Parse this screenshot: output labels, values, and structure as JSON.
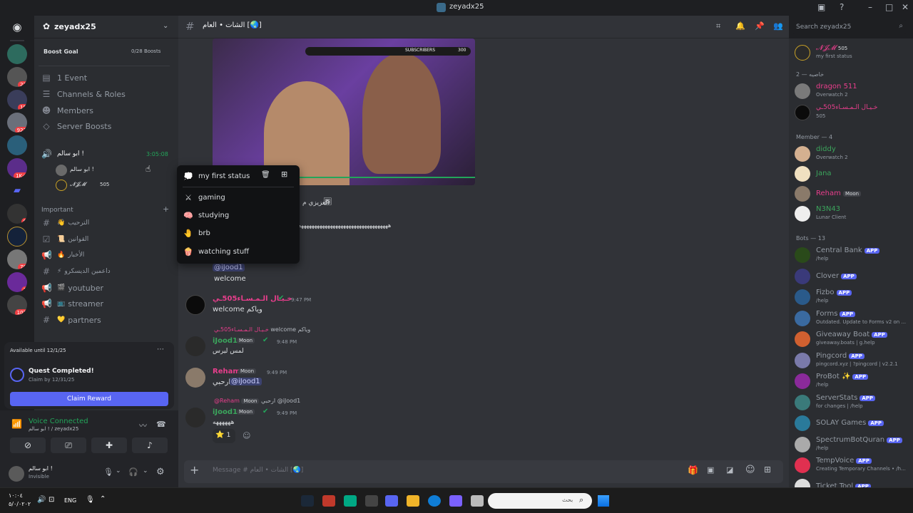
{
  "window": {
    "title": "zeyadx25"
  },
  "colors": {
    "accent": "#5865f2",
    "online": "#23a55a",
    "danger": "#f23f43",
    "pink": "#e83e8c",
    "green_name": "#3ba55c"
  },
  "server": {
    "name": "zeyadx25",
    "boost_goal_label": "Boost Goal",
    "boost_goal_value": "0/28 Boosts",
    "menu": [
      "1 Event",
      "Channels & Roles",
      "Members",
      "Server Boosts"
    ],
    "voice_channel": {
      "name": "ابو سالم !",
      "timer": "3:05:08",
      "users": [
        "ابو سالم !",
        "𝓝𝓙𝓜"
      ],
      "user_tag": "505"
    },
    "category_important": "Important",
    "channels": [
      {
        "icon": "#",
        "emoji": "👋",
        "name": "الترحيب"
      },
      {
        "icon": "☑",
        "emoji": "📜",
        "name": "القوانين"
      },
      {
        "icon": "📢",
        "emoji": "🔥",
        "name": "الأخبار"
      },
      {
        "icon": "#",
        "emoji": "⚡",
        "name": "داعمين الديسكرو"
      },
      {
        "icon": "📢",
        "emoji": "🎬",
        "name": "youtuber"
      },
      {
        "icon": "📢",
        "emoji": "📺",
        "name": "streamer"
      },
      {
        "icon": "#",
        "emoji": "💛",
        "name": "partners"
      }
    ],
    "server_badges": [
      "22",
      "15",
      "923",
      "1K+",
      "6",
      "70",
      "1",
      "102"
    ]
  },
  "quest": {
    "availability": "Available until 12/1/25",
    "title": "Quest Completed!",
    "claim_by": "Claim by 12/31/25",
    "button": "Claim Reward"
  },
  "voice": {
    "status": "Voice Connected",
    "location": "ابو سالم ! / zeyadx25"
  },
  "user": {
    "name": "ابو سالم !",
    "status": "Invisible"
  },
  "chat": {
    "channel_name": "الشات • العام [🌏]",
    "search_placeholder": "Search zeyadx25",
    "video": {
      "overlay_label": "SUBSCRIBERS",
      "overlay_value": "300"
    },
    "after_video_text": "العزيزي م",
    "long_text": "ههههههههههههههههههههههههههههههههههه",
    "messages": [
      {
        "mention": "@iJood1",
        "body": "welcome"
      },
      {
        "author": "خـيـال الـمـسـاء505ـي",
        "time": "9:47 PM",
        "body": "welcome وياكم"
      },
      {
        "reply_to": "خـيـال الـمـسـاء505ـي",
        "reply_text": "welcome وياكم",
        "author": "iJood1",
        "tag": "Moon",
        "time": "9:48 PM",
        "body": "لمس ليرس"
      },
      {
        "author": "Reham",
        "tag": "Moon",
        "time": "9:49 PM",
        "body": "ارحبي",
        "mention": "@iJood1"
      },
      {
        "reply_to": "@Reham",
        "reply_tag": "Moon",
        "reply_text": "ارحبي @iJood1",
        "author": "iJood1",
        "tag": "Moon",
        "time": "9:49 PM",
        "body": "ههههههه",
        "reaction_count": "1"
      }
    ],
    "composer_placeholder": "Message # الشات • العام [🌏]"
  },
  "status_popup": {
    "current": "my first status",
    "options": [
      {
        "emoji": "⚔",
        "label": "gaming"
      },
      {
        "emoji": "🧠",
        "label": "studying"
      },
      {
        "emoji": "🤚",
        "label": "brb"
      },
      {
        "emoji": "🍿",
        "label": "watching stuff"
      }
    ]
  },
  "members": {
    "top_user": {
      "name": "𝓝𝓙𝓜",
      "tag": "505",
      "status": "my first status"
    },
    "category_1": "خاصيه — 2",
    "group_1": [
      {
        "name": "dragon 511",
        "sub": "Overwatch 2",
        "color": "#e83e8c"
      },
      {
        "name": "خـيـال الـمـسـاء505ـي",
        "sub": "505",
        "color": "#e83e8c"
      }
    ],
    "category_2": "Member — 4",
    "group_2": [
      {
        "name": "diddy",
        "sub": "Overwatch 2",
        "color": "#3ba55c"
      },
      {
        "name": "Jana",
        "sub": "",
        "color": "#3ba55c"
      },
      {
        "name": "Reham",
        "sub": "",
        "color": "#e83e8c",
        "tag": "Moon"
      },
      {
        "name": "N3N43",
        "sub": "Lunar Client",
        "color": "#3ba55c"
      }
    ],
    "category_3": "Bots — 13",
    "bots": [
      {
        "name": "Central Bank",
        "sub": "/help"
      },
      {
        "name": "Clover",
        "sub": ""
      },
      {
        "name": "Fizbo",
        "sub": "/help"
      },
      {
        "name": "Forms",
        "sub": "Outdated. Update to Forms v2 on ..."
      },
      {
        "name": "Giveaway Boat",
        "sub": "giveaway.boats | g.help"
      },
      {
        "name": "Pingcord",
        "sub": "pingcord.xyz | ?pingcord | v2.2.1"
      },
      {
        "name": "ProBot ✨",
        "sub": "/help"
      },
      {
        "name": "ServerStats",
        "sub": "for changes | /help"
      },
      {
        "name": "SOLAY Games",
        "sub": ""
      },
      {
        "name": "SpectrumBotQuran",
        "sub": "/help"
      },
      {
        "name": "TempVoice",
        "sub": "Creating Temporary Channels • /h..."
      },
      {
        "name": "Ticket Tool",
        "sub": ""
      }
    ],
    "app_label": "APP"
  },
  "taskbar": {
    "time": "١٠:٠٤",
    "date": "٥/٠/٠٢٠٢",
    "lang": "ENG",
    "search_placeholder": "بحث"
  }
}
